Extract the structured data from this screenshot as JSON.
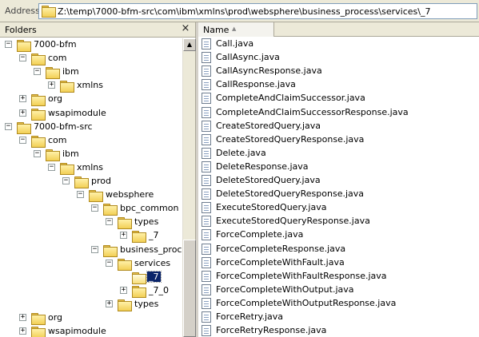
{
  "address": {
    "label": "Address",
    "path": "Z:\\temp\\7000-bfm-src\\com\\ibm\\xmlns\\prod\\websphere\\business_process\\services\\_7"
  },
  "folders_pane": {
    "title": "Folders",
    "close_label": "×",
    "tree": [
      {
        "label": "7000-bfm",
        "level": 0,
        "expander": "−"
      },
      {
        "label": "com",
        "level": 1,
        "expander": "−"
      },
      {
        "label": "ibm",
        "level": 2,
        "expander": "−"
      },
      {
        "label": "xmlns",
        "level": 3,
        "expander": "+"
      },
      {
        "label": "org",
        "level": 1,
        "expander": "+"
      },
      {
        "label": "wsapimodule",
        "level": 1,
        "expander": "+"
      },
      {
        "label": "7000-bfm-src",
        "level": 0,
        "expander": "−"
      },
      {
        "label": "com",
        "level": 1,
        "expander": "−"
      },
      {
        "label": "ibm",
        "level": 2,
        "expander": "−"
      },
      {
        "label": "xmlns",
        "level": 3,
        "expander": "−"
      },
      {
        "label": "prod",
        "level": 4,
        "expander": "−"
      },
      {
        "label": "websphere",
        "level": 5,
        "expander": "−"
      },
      {
        "label": "bpc_common",
        "level": 6,
        "expander": "−"
      },
      {
        "label": "types",
        "level": 7,
        "expander": "−"
      },
      {
        "label": "_7",
        "level": 8,
        "expander": "+"
      },
      {
        "label": "business_proce",
        "level": 6,
        "expander": "−"
      },
      {
        "label": "services",
        "level": 7,
        "expander": "−"
      },
      {
        "label": "_7",
        "level": 8,
        "expander": "",
        "selected": true
      },
      {
        "label": "_7_0",
        "level": 8,
        "expander": "+"
      },
      {
        "label": "types",
        "level": 7,
        "expander": "+"
      },
      {
        "label": "org",
        "level": 1,
        "expander": "+"
      },
      {
        "label": "wsapimodule",
        "level": 1,
        "expander": "+"
      }
    ]
  },
  "file_list": {
    "column_name": "Name",
    "sort_indicator": "▲",
    "files": [
      "Call.java",
      "CallAsync.java",
      "CallAsyncResponse.java",
      "CallResponse.java",
      "CompleteAndClaimSuccessor.java",
      "CompleteAndClaimSuccessorResponse.java",
      "CreateStoredQuery.java",
      "CreateStoredQueryResponse.java",
      "Delete.java",
      "DeleteResponse.java",
      "DeleteStoredQuery.java",
      "DeleteStoredQueryResponse.java",
      "ExecuteStoredQuery.java",
      "ExecuteStoredQueryResponse.java",
      "ForceComplete.java",
      "ForceCompleteResponse.java",
      "ForceCompleteWithFault.java",
      "ForceCompleteWithFaultResponse.java",
      "ForceCompleteWithOutput.java",
      "ForceCompleteWithOutputResponse.java",
      "ForceRetry.java",
      "ForceRetryResponse.java"
    ]
  },
  "scrollbar": {
    "up": "▲",
    "down": "▼"
  }
}
